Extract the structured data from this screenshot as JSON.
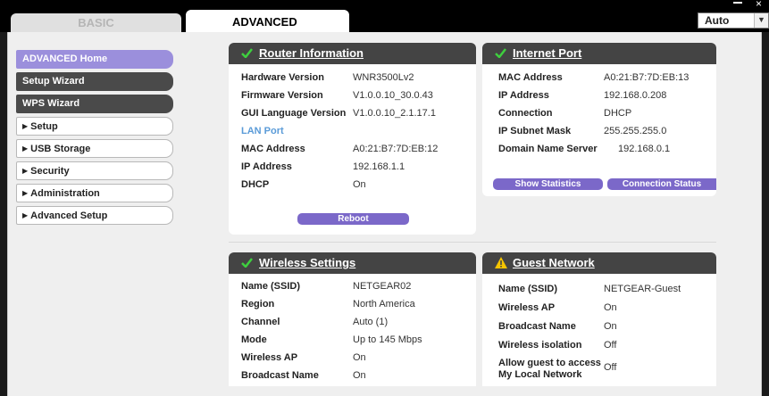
{
  "tabs": {
    "basic": "BASIC",
    "advanced": "ADVANCED"
  },
  "language": {
    "selected": "Auto"
  },
  "window": {
    "minimize": "–",
    "close": "×"
  },
  "menu": {
    "items": [
      {
        "label": "ADVANCED Home"
      },
      {
        "label": "Setup Wizard"
      },
      {
        "label": "WPS Wizard"
      },
      {
        "label": "Setup"
      },
      {
        "label": "USB Storage"
      },
      {
        "label": "Security"
      },
      {
        "label": "Administration"
      },
      {
        "label": "Advanced Setup"
      }
    ]
  },
  "router_info": {
    "title": "Router Information",
    "rows": [
      {
        "label": "Hardware Version",
        "value": "WNR3500Lv2"
      },
      {
        "label": "Firmware Version",
        "value": "V1.0.0.10_30.0.43"
      },
      {
        "label": "GUI Language Version",
        "value": "V1.0.0.10_2.1.17.1"
      },
      {
        "label": "LAN Port",
        "value": ""
      },
      {
        "label": "MAC Address",
        "value": "A0:21:B7:7D:EB:12"
      },
      {
        "label": "IP Address",
        "value": "192.168.1.1"
      },
      {
        "label": "DHCP",
        "value": "On"
      }
    ],
    "reboot_button": "Reboot"
  },
  "internet_port": {
    "title": "Internet Port",
    "rows": [
      {
        "label": "MAC Address",
        "value": "A0:21:B7:7D:EB:13"
      },
      {
        "label": "IP Address",
        "value": "192.168.0.208"
      },
      {
        "label": "Connection",
        "value": "DHCP"
      },
      {
        "label": "IP Subnet Mask",
        "value": "255.255.255.0"
      },
      {
        "label": "Domain Name Server",
        "value": "192.168.0.1"
      }
    ],
    "show_statistics_button": "Show Statistics",
    "connection_status_button": "Connection Status"
  },
  "wireless_settings": {
    "title": "Wireless Settings",
    "rows": [
      {
        "label": "Name (SSID)",
        "value": "NETGEAR02"
      },
      {
        "label": "Region",
        "value": "North America"
      },
      {
        "label": "Channel",
        "value": "Auto (1)"
      },
      {
        "label": "Mode",
        "value": "Up to 145 Mbps"
      },
      {
        "label": "Wireless AP",
        "value": "On"
      },
      {
        "label": "Broadcast Name",
        "value": "On"
      }
    ]
  },
  "guest_network": {
    "title": "Guest Network",
    "rows": [
      {
        "label": "Name (SSID)",
        "value": "NETGEAR-Guest"
      },
      {
        "label": "Wireless AP",
        "value": "On"
      },
      {
        "label": "Broadcast Name",
        "value": "On"
      },
      {
        "label": "Wireless isolation",
        "value": "Off"
      }
    ],
    "allow_access_label_1": "Allow guest to access",
    "allow_access_label_2": "My Local Network",
    "allow_access_value": "Off"
  },
  "colors": {
    "accent_purple": "#7b68c9",
    "home_purple": "#9b8fdc",
    "header_dark": "#444444",
    "check_green": "#2db52d",
    "warn_yellow": "#f5c400",
    "lan_blue": "#5a9bd8"
  },
  "icons": {
    "check": "check-icon",
    "warning": "warning-icon",
    "dropdown": "chevron-down-icon"
  }
}
